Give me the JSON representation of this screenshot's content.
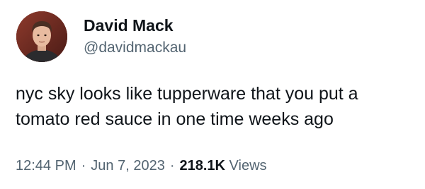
{
  "tweet": {
    "author": {
      "display_name": "David Mack",
      "handle": "@davidmackau"
    },
    "text_lines": [
      "nyc sky looks like tupperware that you put a",
      "tomato red sauce in one time weeks ago"
    ],
    "meta": {
      "time": "12:44 PM",
      "date": "Jun 7, 2023",
      "separator": "·",
      "views_count": "218.1K",
      "views_label": "Views"
    }
  },
  "colors": {
    "text_primary": "#0f1419",
    "text_secondary": "#536471",
    "background": "#ffffff"
  },
  "icons": {
    "avatar": "profile-photo"
  }
}
